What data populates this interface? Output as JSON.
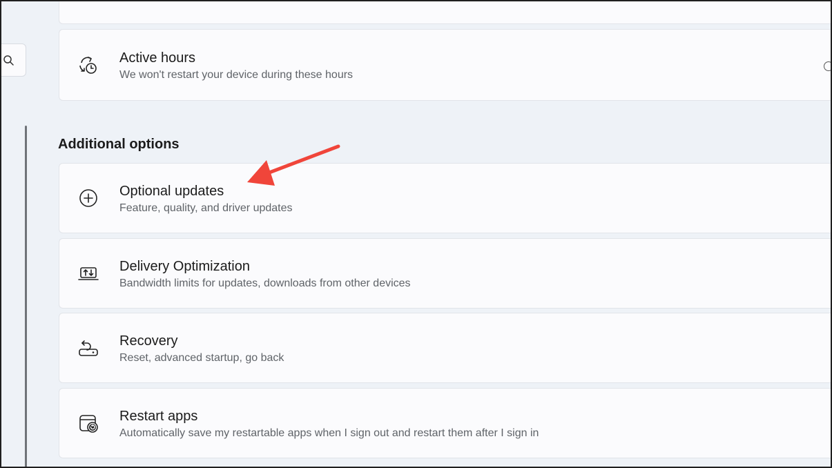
{
  "search": {
    "icon": "search-icon"
  },
  "cards": {
    "active_hours": {
      "icon": "clock-sync-icon",
      "title": "Active hours",
      "subtitle": "We won't restart your device during these hours"
    }
  },
  "additional_options": {
    "heading": "Additional options",
    "items": [
      {
        "icon": "plus-circle-icon",
        "title": "Optional updates",
        "subtitle": "Feature, quality, and driver updates"
      },
      {
        "icon": "delivery-optimization-icon",
        "title": "Delivery Optimization",
        "subtitle": "Bandwidth limits for updates, downloads from other devices"
      },
      {
        "icon": "recovery-icon",
        "title": "Recovery",
        "subtitle": "Reset, advanced startup, go back"
      },
      {
        "icon": "restart-apps-icon",
        "title": "Restart apps",
        "subtitle": "Automatically save my restartable apps when I sign out and restart them after I sign in"
      }
    ]
  },
  "annotation": {
    "arrow_color": "#f0453a",
    "icon": "red-arrow-annotation"
  }
}
